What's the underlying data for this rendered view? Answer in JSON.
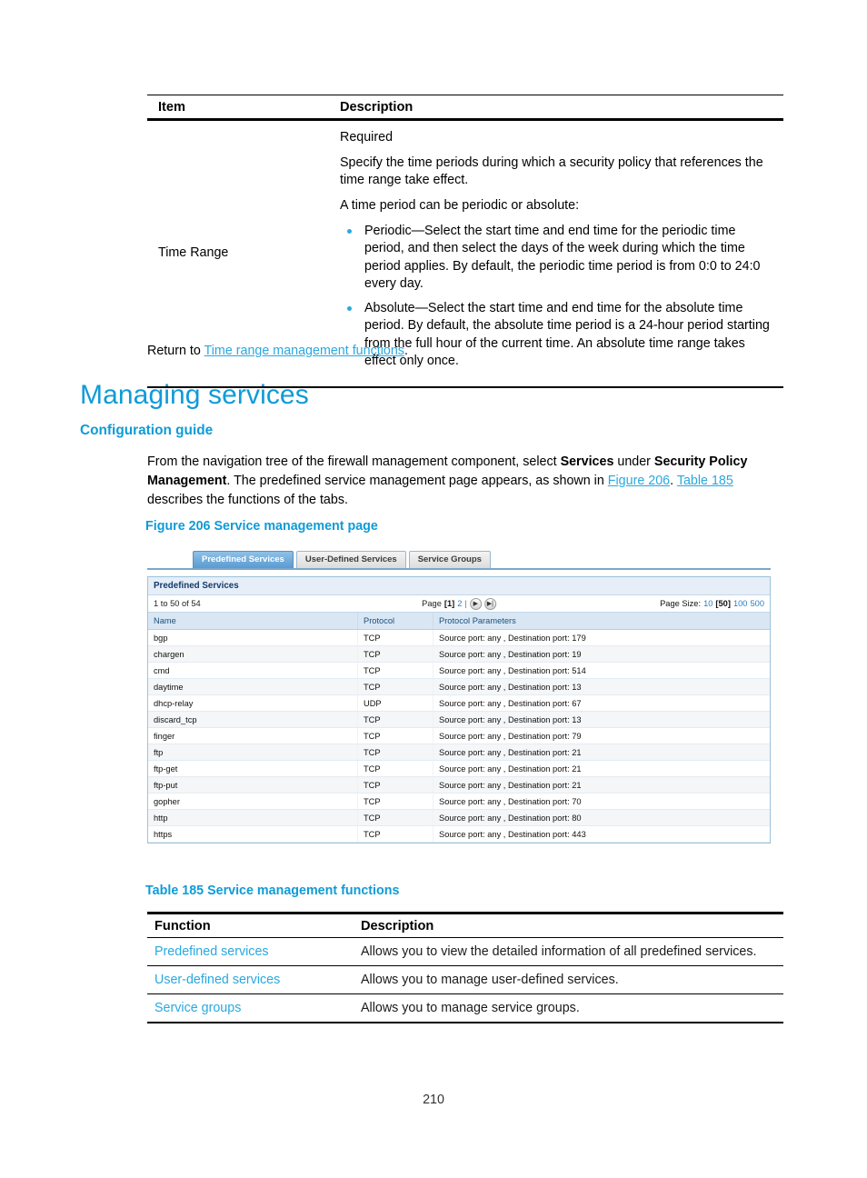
{
  "colors": {
    "link": "#29a8df",
    "heading": "#0f9bd7",
    "tab_active_bg": "#5a9bd2",
    "panel_title_bg": "#e6eef8",
    "table_header_bg": "#d9e7f4"
  },
  "top_table": {
    "headers": {
      "item": "Item",
      "description": "Description"
    },
    "row": {
      "item": "Time Range",
      "paragraphs": [
        "Required",
        "Specify the time periods during which a security policy that references the time range take effect.",
        "A time period can be periodic or absolute:"
      ],
      "bullets": [
        "Periodic—Select the start time and end time for the periodic time period, and then select the days of the week during which the time period applies. By default, the periodic time period is from 0:0 to 24:0 every day.",
        "Absolute—Select the start time and end time for the absolute time period. By default, the absolute time period is a 24-hour period starting from the full hour of the current time. An absolute time range takes effect only once."
      ]
    }
  },
  "return_line": {
    "prefix": "Return to ",
    "link": "Time range management functions",
    "suffix": "."
  },
  "headings": {
    "h1": "Managing services",
    "h2": "Configuration guide"
  },
  "intro": {
    "seg1": "From the navigation tree of the firewall management component, select ",
    "bold1": "Services",
    "seg2": " under ",
    "bold2": "Security Policy Management",
    "seg3": ". The predefined service management page appears, as shown in ",
    "link1": "Figure 206",
    "seg4": ". ",
    "link2": "Table 185",
    "seg5": " describes the functions of the tabs."
  },
  "figure": {
    "caption": "Figure 206 Service management page"
  },
  "screenshot": {
    "tabs": [
      {
        "label": "Predefined Services",
        "active": true
      },
      {
        "label": "User-Defined Services",
        "active": false
      },
      {
        "label": "Service Groups",
        "active": false
      }
    ],
    "panel_title": "Predefined Services",
    "pager": {
      "count_text": "1 to 50 of 54",
      "page_label": "Page",
      "current_page": "[1]",
      "next_page": "2",
      "separator": "|",
      "next_icon": "▶",
      "last_icon": "▶|",
      "page_size_label": "Page Size:",
      "page_size_options": [
        "10",
        "50",
        "100",
        "500"
      ],
      "page_size_selected": "50"
    },
    "columns": [
      "Name",
      "Protocol",
      "Protocol Parameters"
    ],
    "rows": [
      {
        "name": "bgp",
        "protocol": "TCP",
        "params": "Source port: any , Destination port: 179"
      },
      {
        "name": "chargen",
        "protocol": "TCP",
        "params": "Source port: any , Destination port: 19"
      },
      {
        "name": "cmd",
        "protocol": "TCP",
        "params": "Source port: any , Destination port: 514"
      },
      {
        "name": "daytime",
        "protocol": "TCP",
        "params": "Source port: any , Destination port: 13"
      },
      {
        "name": "dhcp-relay",
        "protocol": "UDP",
        "params": "Source port: any , Destination port: 67"
      },
      {
        "name": "discard_tcp",
        "protocol": "TCP",
        "params": "Source port: any , Destination port: 13"
      },
      {
        "name": "finger",
        "protocol": "TCP",
        "params": "Source port: any , Destination port: 79"
      },
      {
        "name": "ftp",
        "protocol": "TCP",
        "params": "Source port: any , Destination port: 21"
      },
      {
        "name": "ftp-get",
        "protocol": "TCP",
        "params": "Source port: any , Destination port: 21"
      },
      {
        "name": "ftp-put",
        "protocol": "TCP",
        "params": "Source port: any , Destination port: 21"
      },
      {
        "name": "gopher",
        "protocol": "TCP",
        "params": "Source port: any , Destination port: 70"
      },
      {
        "name": "http",
        "protocol": "TCP",
        "params": "Source port: any , Destination port: 80"
      },
      {
        "name": "https",
        "protocol": "TCP",
        "params": "Source port: any , Destination port: 443"
      }
    ]
  },
  "bottom_table": {
    "caption": "Table 185 Service management functions",
    "headers": {
      "function": "Function",
      "description": "Description"
    },
    "rows": [
      {
        "function": "Predefined services",
        "description": "Allows you to view the detailed information of all predefined services."
      },
      {
        "function": "User-defined services",
        "description": "Allows you to manage user-defined services."
      },
      {
        "function": "Service groups",
        "description": "Allows you to manage service groups."
      }
    ]
  },
  "footer": {
    "page_number": "210"
  }
}
